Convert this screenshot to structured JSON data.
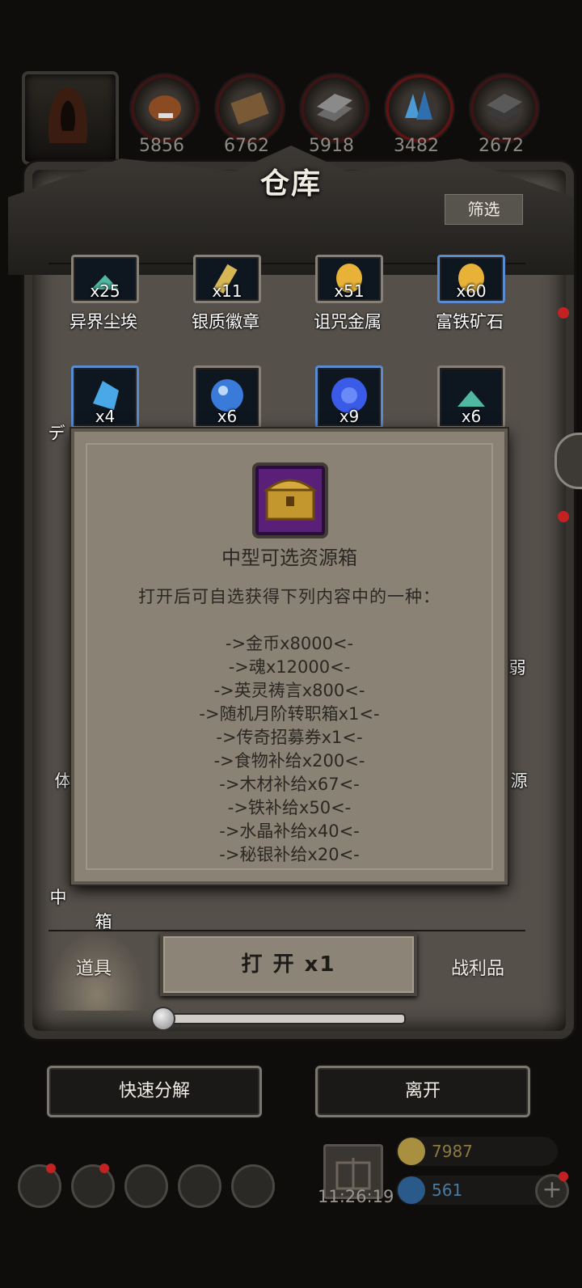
{
  "resources": [
    {
      "value": "5856",
      "icon": "food-icon",
      "color": "#8a4a22"
    },
    {
      "value": "6762",
      "icon": "wood-icon",
      "color": "#7a5a36"
    },
    {
      "value": "5918",
      "icon": "iron-icon",
      "color": "#5a5a5a"
    },
    {
      "value": "3482",
      "icon": "crystal-icon",
      "color": "#2f6fae"
    },
    {
      "value": "2672",
      "icon": "mithril-icon",
      "color": "#4a4a4a"
    }
  ],
  "panel": {
    "title": "仓库",
    "filter_label": "筛选"
  },
  "items_row1": [
    {
      "qty": "x25",
      "label": "异界尘埃",
      "icon": "dust-icon",
      "color": "#4fb8a0"
    },
    {
      "qty": "x11",
      "label": "银质徽章",
      "icon": "badge-icon",
      "color": "#d6b655"
    },
    {
      "qty": "x51",
      "label": "诅咒金属",
      "icon": "cursed-metal-icon",
      "color": "#e8b238"
    },
    {
      "qty": "x60",
      "label": "富铁矿石",
      "icon": "iron-ore-icon",
      "color": "#e8b238"
    }
  ],
  "items_row2": [
    {
      "qty": "x4",
      "icon": "crystal-shard-icon",
      "color": "#48a8e8"
    },
    {
      "qty": "x6",
      "icon": "blue-orb-icon",
      "color": "#3a7ad8"
    },
    {
      "qty": "x9",
      "icon": "blue-vortex-icon",
      "color": "#3a5ae8"
    },
    {
      "qty": "x6",
      "icon": "dust-icon",
      "color": "#4fb8a0"
    }
  ],
  "partial_labels": {
    "row2_left": "デ",
    "right_mid": "弱",
    "left_low": "体",
    "right_low": "源",
    "bottom_left_1": "中",
    "bottom_left_2": "箱"
  },
  "modal": {
    "title": "中型可选资源箱",
    "description": "打开后可自选获得下列内容中的一种：",
    "options": [
      "->金币x8000<-",
      "->魂x12000<-",
      "->英灵祷言x800<-",
      "->随机月阶转职箱x1<-",
      "->传奇招募券x1<-",
      "->食物补给x200<-",
      "->木材补给x67<-",
      "->铁补给x50<-",
      "->水晶补给x40<-",
      "->秘银补给x20<-"
    ]
  },
  "tabs": {
    "left": "道具",
    "right": "战利品"
  },
  "open_button": "打 开 x1",
  "slider": {
    "value_fraction": 0.0
  },
  "buttons": {
    "quick_decompose": "快速分解",
    "leave": "离开"
  },
  "hud": {
    "time": "11:26:19",
    "gold": "7987",
    "gems": "561"
  }
}
